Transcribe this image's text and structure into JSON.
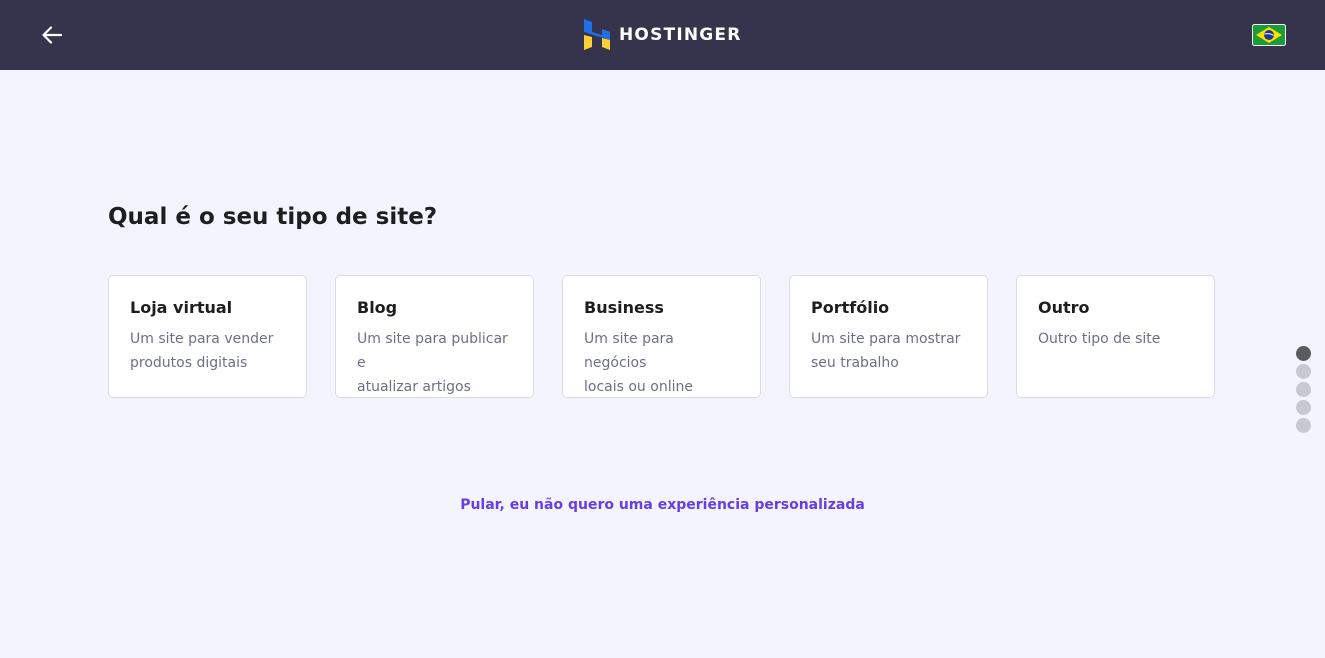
{
  "header": {
    "back_icon": "arrow-left-icon",
    "logo_text": "HOSTINGER",
    "language_flag": "brazil-flag-icon",
    "colors": {
      "bar": "#36344d",
      "logo_blue": "#1f6fe5",
      "logo_yellow": "#ffcd35"
    }
  },
  "main": {
    "title": "Qual é o seu tipo de site?",
    "cards": [
      {
        "title": "Loja virtual",
        "line1": "Um site para vender",
        "line2": "produtos digitais"
      },
      {
        "title": "Blog",
        "line1": "Um site para publicar e",
        "line2": "atualizar artigos"
      },
      {
        "title": "Business",
        "line1": "Um site para negócios",
        "line2": "locais ou online"
      },
      {
        "title": "Portfólio",
        "line1": "Um site para mostrar",
        "line2": "seu trabalho"
      },
      {
        "title": "Outro",
        "line1": "Outro tipo de site",
        "line2": ""
      }
    ],
    "skip_label": "Pular, eu não quero uma experiência personalizada",
    "accent_color": "#673de6"
  },
  "progress": {
    "total_steps": 5,
    "current_step": 1
  }
}
